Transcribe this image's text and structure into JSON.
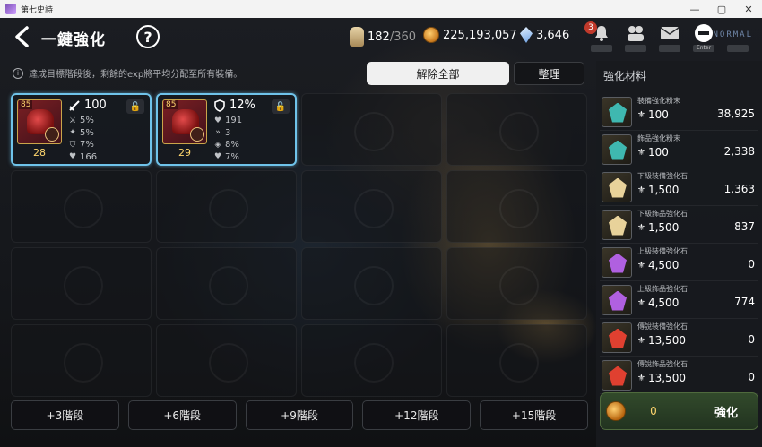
{
  "window": {
    "title": "第七史詩",
    "controls": [
      "—",
      "▢",
      "✕"
    ]
  },
  "header": {
    "title": "一鍵強化",
    "help": "?",
    "stamina": {
      "value": "182",
      "max": "/360"
    },
    "gold": "225,193,057",
    "crystal": "3,646",
    "notification_badge": "3",
    "enter_key": "Enter",
    "mode": "NORMAL"
  },
  "info_text": "達成目標階段後，剩餘的exp將平均分配至所有裝備。",
  "buttons": {
    "unequip_all": "解除全部",
    "sort": "整理"
  },
  "equipment": [
    {
      "level": "85",
      "enhance": "28",
      "main_stat": "100",
      "stats": [
        "5%",
        "5%",
        "7%",
        "166"
      ],
      "colors": {
        "accent": "#6fc3ea"
      }
    },
    {
      "level": "85",
      "enhance": "29",
      "main_stat": "12%",
      "stats": [
        "191",
        "3",
        "8%",
        "7%"
      ],
      "colors": {
        "accent": "#6fc3ea"
      }
    }
  ],
  "tiers": [
    "+3階段",
    "+6階段",
    "+9階段",
    "+12階段",
    "+15階段"
  ],
  "panel": {
    "title": "強化材料",
    "materials": [
      {
        "name": "裝備強化粉末",
        "cost": "100",
        "count": "38,925",
        "color": "#3fb8b0"
      },
      {
        "name": "飾品強化粉末",
        "cost": "100",
        "count": "2,338",
        "color": "#3fb8b0"
      },
      {
        "name": "下級裝備強化石",
        "cost": "1,500",
        "count": "1,363",
        "color": "#e8d29a"
      },
      {
        "name": "下級飾品強化石",
        "cost": "1,500",
        "count": "837",
        "color": "#e8d29a"
      },
      {
        "name": "上級裝備強化石",
        "cost": "4,500",
        "count": "0",
        "color": "#b060e0"
      },
      {
        "name": "上級飾品強化石",
        "cost": "4,500",
        "count": "774",
        "color": "#b060e0"
      },
      {
        "name": "傳說裝備強化石",
        "cost": "13,500",
        "count": "0",
        "color": "#e04030"
      },
      {
        "name": "傳說飾品強化石",
        "cost": "13,500",
        "count": "0",
        "color": "#e04030"
      }
    ],
    "enhance": {
      "cost": "0",
      "label": "強化"
    }
  }
}
